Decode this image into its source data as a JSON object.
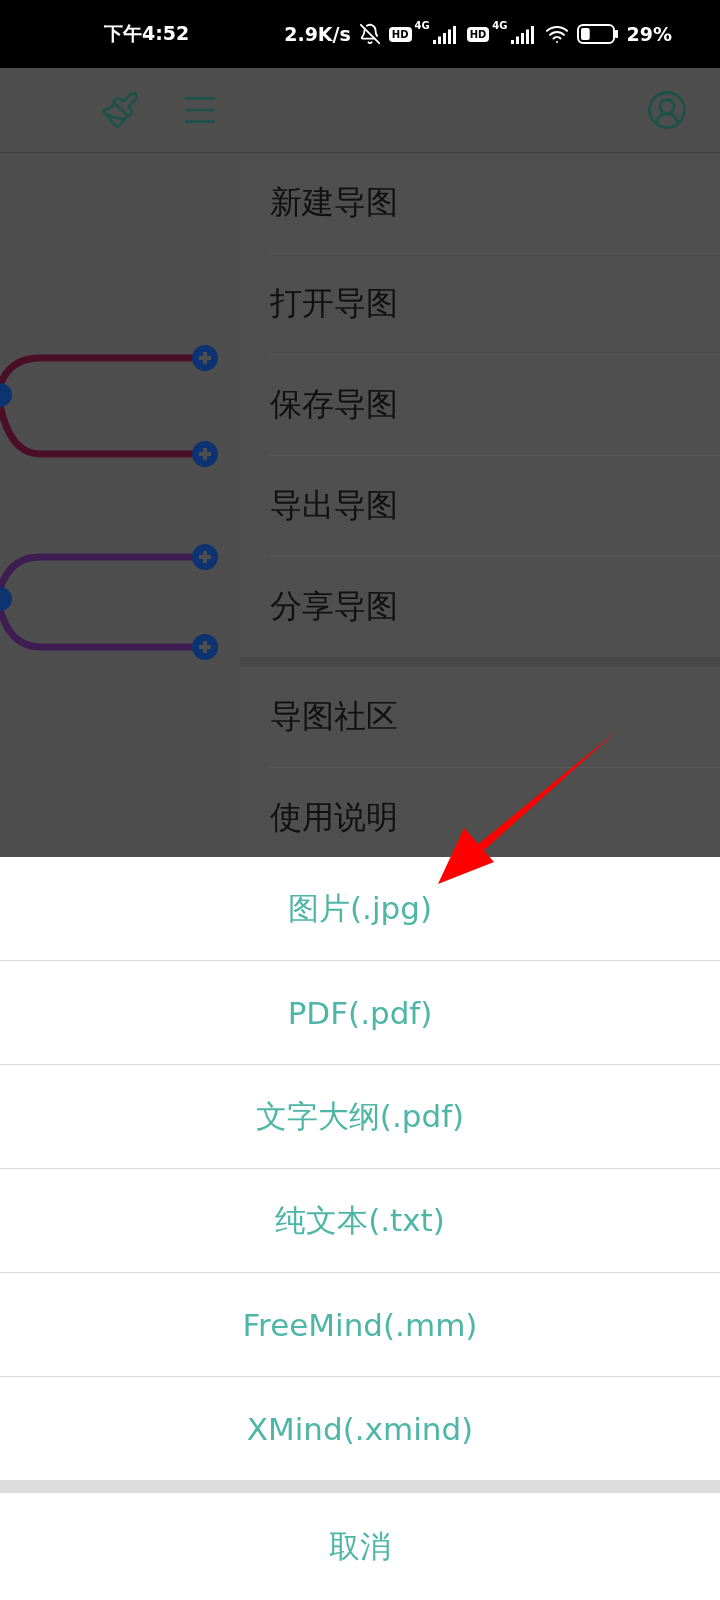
{
  "status_bar": {
    "time": "下午4:52",
    "speed": "2.9K/s",
    "sims": [
      {
        "hd": "HD",
        "network": "4G"
      },
      {
        "hd": "HD",
        "network": "4G"
      }
    ],
    "battery": {
      "level": 0.29,
      "percent": "29%"
    }
  },
  "menu": {
    "groups": [
      [
        "新建导图",
        "打开导图",
        "保存导图",
        "导出导图",
        "分享导图"
      ],
      [
        "导图社区",
        "使用说明"
      ]
    ]
  },
  "export_sheet": {
    "options": [
      "图片(.jpg)",
      "PDF(.pdf)",
      "文字大纲(.pdf)",
      "纯文本(.txt)",
      "FreeMind(.mm)",
      "XMind(.xmind)"
    ],
    "cancel": "取消"
  }
}
